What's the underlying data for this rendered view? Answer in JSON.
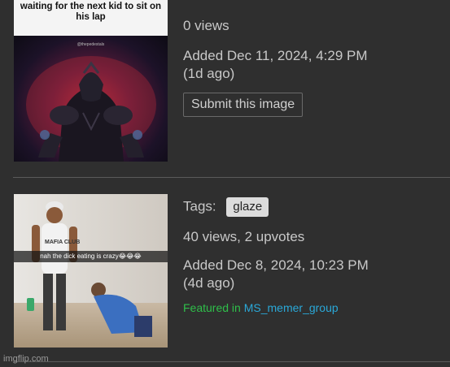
{
  "posts": [
    {
      "image": {
        "caption": "waiting for the next kid to sit on his lap",
        "watermark": "@thepedestals"
      },
      "views": "0 views",
      "added": "Added Dec 11, 2024, 4:29 PM",
      "ago": "(1d ago)",
      "submit_label": "Submit this image"
    },
    {
      "image": {
        "caption": "nah the dick eating is crazy😂😂😂",
        "shirt_text": "MAFIA CLUB"
      },
      "tags_label": "Tags:",
      "tags": [
        "glaze"
      ],
      "stats": "40 views, 2 upvotes",
      "added": "Added Dec 8, 2024, 10:23 PM",
      "ago": "(4d ago)",
      "featured_label": "Featured in",
      "featured_group": "MS_memer_group"
    }
  ],
  "watermark": "imgflip.com",
  "colors": {
    "background": "#2f2f2f",
    "text": "#c8c8c8",
    "featured_label": "#2fbf4a",
    "featured_link": "#2aa8d8",
    "tag_bg": "#dcdcdc"
  }
}
